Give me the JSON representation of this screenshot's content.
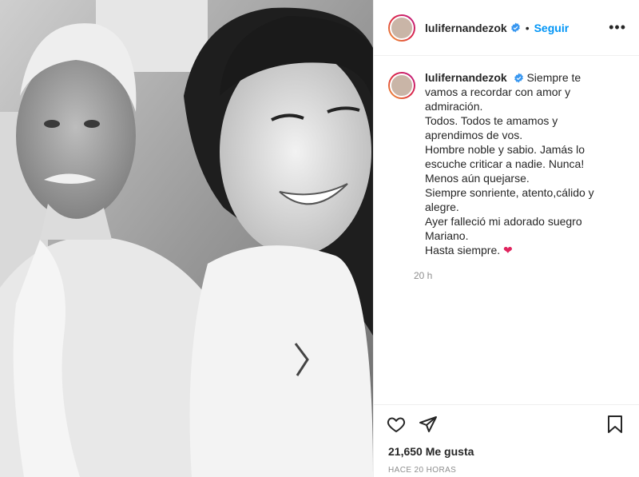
{
  "post": {
    "username": "lulifernandezok",
    "verified_icon": "verified-badge-icon",
    "separator": "•",
    "follow_label": "Seguir",
    "more_label": "•••",
    "caption_text": "Siempre te vamos a recordar con amor y admiración.\nTodos. Todos te amamos y aprendimos de vos.\nHombre noble y sabio. Jamás lo escuche criticar a nadie. Nunca!\nMenos aún quejarse.\nSiempre sonriente, atento,cálido y alegre.\nAyer falleció mi adorado suegro Mariano.\nHasta siempre. ",
    "caption_heart": "❤",
    "comment_time": "20 h",
    "likes_count": "21,650",
    "likes_label": "Me gusta",
    "posted_time": "HACE 20 HORAS"
  },
  "icons": {
    "like": "heart-outline-icon",
    "share": "paper-plane-icon",
    "save": "bookmark-icon",
    "more": "ellipsis-icon"
  },
  "colors": {
    "accent": "#0095f6",
    "text": "#262626",
    "muted": "#8e8e8e",
    "heart": "#e0245e"
  }
}
